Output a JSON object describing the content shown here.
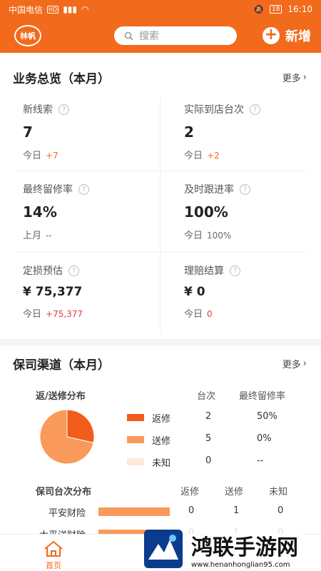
{
  "status_bar": {
    "carrier": "中国电信",
    "network": "HD",
    "signal": "4G",
    "battery": "18",
    "time": "16:10"
  },
  "header": {
    "logo": "林帆",
    "search_placeholder": "搜索",
    "new_label": "新增"
  },
  "overview": {
    "title": "业务总览（本月）",
    "more": "更多",
    "cells": [
      {
        "label": "新线索",
        "value": "7",
        "sub_label": "今日",
        "delta": "+7"
      },
      {
        "label": "实际到店台次",
        "value": "2",
        "sub_label": "今日",
        "delta": "+2"
      },
      {
        "label": "最终留修率",
        "value": "14%",
        "sub_label": "上月",
        "delta": "--"
      },
      {
        "label": "及时跟进率",
        "value": "100%",
        "sub_label": "今日",
        "delta": "100%"
      },
      {
        "label": "定损预估",
        "value": "¥ 75,377",
        "sub_label": "今日",
        "delta": "+75,377"
      },
      {
        "label": "理赔结算",
        "value": "¥ 0",
        "sub_label": "今日",
        "delta": "0"
      }
    ]
  },
  "channel": {
    "title": "保司渠道（本月）",
    "more": "更多",
    "dist_title": "返/送修分布",
    "col_count": "台次",
    "col_rate": "最终留修率",
    "rows": [
      {
        "name": "返修",
        "count": "2",
        "rate": "50%",
        "color": "#f25c1a",
        "share": 0.2857
      },
      {
        "name": "送修",
        "count": "5",
        "rate": "0%",
        "color": "#fa9a5a",
        "share": 0.7143
      },
      {
        "name": "未知",
        "count": "0",
        "rate": "--",
        "color": "#fde8dc",
        "share": 0
      }
    ],
    "insurer_title": "保司台次分布",
    "insurer_cols": [
      "返修",
      "送修",
      "未知"
    ],
    "insurers": [
      {
        "name": "平安财险",
        "fanxiu": "0",
        "songxiu": "1",
        "unknown": "0",
        "share": 1.0
      },
      {
        "name": "太平洋财险",
        "fanxiu": "0",
        "songxiu": "1",
        "unknown": "0",
        "share": 1.0
      }
    ]
  },
  "tabbar": {
    "home": "首页"
  },
  "watermark": {
    "title": "鸿联手游网",
    "url": "www.henanhonglian95.com"
  }
}
